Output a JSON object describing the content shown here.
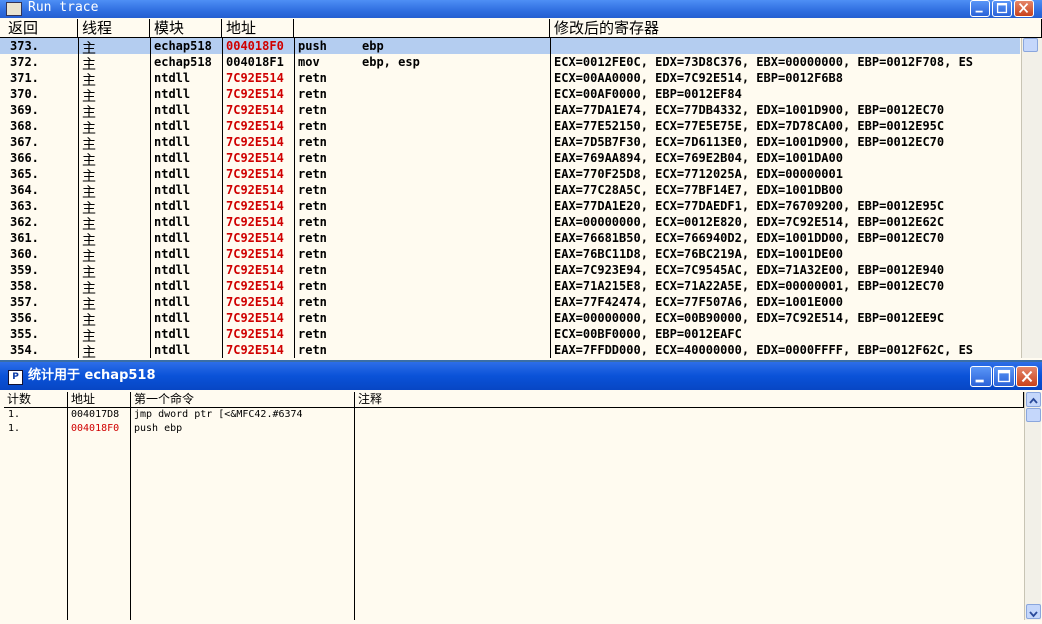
{
  "run_trace": {
    "title": "Run trace",
    "columns": [
      "返回",
      "线程",
      "模块",
      "地址",
      "",
      "修改后的寄存器"
    ],
    "thread_glyph": "主",
    "rows": [
      {
        "idx": "373.",
        "module": "echap518",
        "addr": "004018F0",
        "addr_red": true,
        "mnemonic": "push",
        "operand": "ebp",
        "regs": "",
        "selected": true
      },
      {
        "idx": "372.",
        "module": "echap518",
        "addr": "004018F1",
        "addr_red": false,
        "mnemonic": "mov",
        "operand": "ebp, esp",
        "regs": "ECX=0012FE0C, EDX=73D8C376, EBX=00000000, EBP=0012F708, ES"
      },
      {
        "idx": "371.",
        "module": "ntdll",
        "addr": "7C92E514",
        "addr_red": true,
        "mnemonic": "retn",
        "operand": "",
        "regs": "ECX=00AA0000, EDX=7C92E514, EBP=0012F6B8"
      },
      {
        "idx": "370.",
        "module": "ntdll",
        "addr": "7C92E514",
        "addr_red": true,
        "mnemonic": "retn",
        "operand": "",
        "regs": "ECX=00AF0000, EBP=0012EF84"
      },
      {
        "idx": "369.",
        "module": "ntdll",
        "addr": "7C92E514",
        "addr_red": true,
        "mnemonic": "retn",
        "operand": "",
        "regs": "EAX=77DA1E74, ECX=77DB4332, EDX=1001D900, EBP=0012EC70"
      },
      {
        "idx": "368.",
        "module": "ntdll",
        "addr": "7C92E514",
        "addr_red": true,
        "mnemonic": "retn",
        "operand": "",
        "regs": "EAX=77E52150, ECX=77E5E75E, EDX=7D78CA00, EBP=0012E95C"
      },
      {
        "idx": "367.",
        "module": "ntdll",
        "addr": "7C92E514",
        "addr_red": true,
        "mnemonic": "retn",
        "operand": "",
        "regs": "EAX=7D5B7F30, ECX=7D6113E0, EDX=1001D900, EBP=0012EC70"
      },
      {
        "idx": "366.",
        "module": "ntdll",
        "addr": "7C92E514",
        "addr_red": true,
        "mnemonic": "retn",
        "operand": "",
        "regs": "EAX=769AA894, ECX=769E2B04, EDX=1001DA00"
      },
      {
        "idx": "365.",
        "module": "ntdll",
        "addr": "7C92E514",
        "addr_red": true,
        "mnemonic": "retn",
        "operand": "",
        "regs": "EAX=770F25D8, ECX=7712025A, EDX=00000001"
      },
      {
        "idx": "364.",
        "module": "ntdll",
        "addr": "7C92E514",
        "addr_red": true,
        "mnemonic": "retn",
        "operand": "",
        "regs": "EAX=77C28A5C, ECX=77BF14E7, EDX=1001DB00"
      },
      {
        "idx": "363.",
        "module": "ntdll",
        "addr": "7C92E514",
        "addr_red": true,
        "mnemonic": "retn",
        "operand": "",
        "regs": "EAX=77DA1E20, ECX=77DAEDF1, EDX=76709200, EBP=0012E95C"
      },
      {
        "idx": "362.",
        "module": "ntdll",
        "addr": "7C92E514",
        "addr_red": true,
        "mnemonic": "retn",
        "operand": "",
        "regs": "EAX=00000000, ECX=0012E820, EDX=7C92E514, EBP=0012E62C"
      },
      {
        "idx": "361.",
        "module": "ntdll",
        "addr": "7C92E514",
        "addr_red": true,
        "mnemonic": "retn",
        "operand": "",
        "regs": "EAX=76681B50, ECX=766940D2, EDX=1001DD00, EBP=0012EC70"
      },
      {
        "idx": "360.",
        "module": "ntdll",
        "addr": "7C92E514",
        "addr_red": true,
        "mnemonic": "retn",
        "operand": "",
        "regs": "EAX=76BC11D8, ECX=76BC219A, EDX=1001DE00"
      },
      {
        "idx": "359.",
        "module": "ntdll",
        "addr": "7C92E514",
        "addr_red": true,
        "mnemonic": "retn",
        "operand": "",
        "regs": "EAX=7C923E94, ECX=7C9545AC, EDX=71A32E00, EBP=0012E940"
      },
      {
        "idx": "358.",
        "module": "ntdll",
        "addr": "7C92E514",
        "addr_red": true,
        "mnemonic": "retn",
        "operand": "",
        "regs": "EAX=71A215E8, ECX=71A22A5E, EDX=00000001, EBP=0012EC70"
      },
      {
        "idx": "357.",
        "module": "ntdll",
        "addr": "7C92E514",
        "addr_red": true,
        "mnemonic": "retn",
        "operand": "",
        "regs": "EAX=77F42474, ECX=77F507A6, EDX=1001E000"
      },
      {
        "idx": "356.",
        "module": "ntdll",
        "addr": "7C92E514",
        "addr_red": true,
        "mnemonic": "retn",
        "operand": "",
        "regs": "EAX=00000000, ECX=00B90000, EDX=7C92E514, EBP=0012EE9C"
      },
      {
        "idx": "355.",
        "module": "ntdll",
        "addr": "7C92E514",
        "addr_red": true,
        "mnemonic": "retn",
        "operand": "",
        "regs": "ECX=00BF0000, EBP=0012EAFC"
      },
      {
        "idx": "354.",
        "module": "ntdll",
        "addr": "7C92E514",
        "addr_red": true,
        "mnemonic": "retn",
        "operand": "",
        "regs": "EAX=7FFDD000, ECX=40000000, EDX=0000FFFF, EBP=0012F62C, ES"
      }
    ]
  },
  "stats": {
    "title": "统计用于 echap518",
    "icon_letter": "P",
    "columns": [
      "计数",
      "地址",
      "第一个命令",
      "注释"
    ],
    "rows": [
      {
        "count": "1.",
        "addr": "004017D8",
        "addr_red": false,
        "cmd": "jmp     dword ptr [<&MFC42.#6374",
        "note": ""
      },
      {
        "count": "1.",
        "addr": "004018F0",
        "addr_red": true,
        "cmd": "push    ebp",
        "note": ""
      }
    ]
  },
  "colors": {
    "addr_red": "#d00000",
    "selection": "#b4cdf0",
    "background": "#fffbf0",
    "titlebar": "#0a52d8"
  }
}
